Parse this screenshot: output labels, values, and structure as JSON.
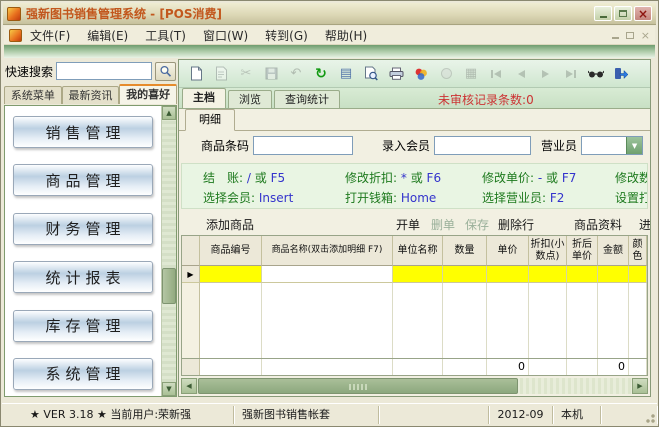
{
  "window": {
    "title": "强新图书销售管理系统 - [POS消费]"
  },
  "menu": {
    "items": [
      "文件(F)",
      "编辑(E)",
      "工具(T)",
      "窗口(W)",
      "转到(G)",
      "帮助(H)"
    ]
  },
  "sidebar": {
    "search_label": "快速搜索",
    "search_value": "",
    "tabs": [
      "系统菜单",
      "最新资讯",
      "我的喜好"
    ],
    "active_tab": "我的喜好",
    "buttons": [
      "销售管理",
      "商品管理",
      "财务管理",
      "统计报表",
      "库存管理",
      "系统管理"
    ]
  },
  "toolbar": {
    "icons": [
      "new-doc",
      "open-doc",
      "cut",
      "save",
      "undo",
      "refresh",
      "bill",
      "print-preview",
      "print",
      "design",
      "stamp",
      "grid",
      "nav-first",
      "nav-prev",
      "nav-next",
      "nav-last",
      "glasses",
      "exit"
    ]
  },
  "main": {
    "tabs": [
      "主档",
      "浏览",
      "查询统计"
    ],
    "active_tab": "主档",
    "notice": "未审核记录条数:0",
    "detail_tab": "明细",
    "form": {
      "barcode_label": "商品条码",
      "barcode_value": "",
      "member_label": "录入会员",
      "member_value": "",
      "clerk_label": "营业员",
      "clerk_value": ""
    },
    "hotkeys": {
      "checkout_label": "结　账:",
      "checkout_key1": "/",
      "checkout_sep": "或",
      "checkout_key2": "F5",
      "discount_label": "修改折扣:",
      "discount_key1": "*",
      "discount_sep": "或",
      "discount_key2": "F6",
      "price_label": "修改单价:",
      "price_key1": "-",
      "price_sep": "或",
      "price_key2": "F7",
      "qty_label": "修改数",
      "member_label": "选择会员:",
      "member_key": "Insert",
      "drawer_label": "打开钱箱:",
      "drawer_key": "Home",
      "clerk_label": "选择营业员:",
      "clerk_key": "F2",
      "setting_label": "设置打"
    },
    "actions": {
      "add_item": "添加商品",
      "open_bill": "开单",
      "void_bill": "删单",
      "save": "保存",
      "delete_row": "删除行",
      "item_info": "商品资料",
      "more": "进"
    },
    "table": {
      "columns": [
        "商品编号",
        "商品名称(双击添加明细 F7)",
        "单位名称",
        "数量",
        "单价",
        "折扣(小数点)",
        "折后单价",
        "金额",
        "颜色"
      ],
      "total_price": "0",
      "total_amount": "0"
    }
  },
  "statusbar": {
    "version_user": "★ VER 3.18 ★  当前用户:荣新强",
    "account": "强新图书销售帐套",
    "period": "2012-09",
    "machine": "本机"
  }
}
